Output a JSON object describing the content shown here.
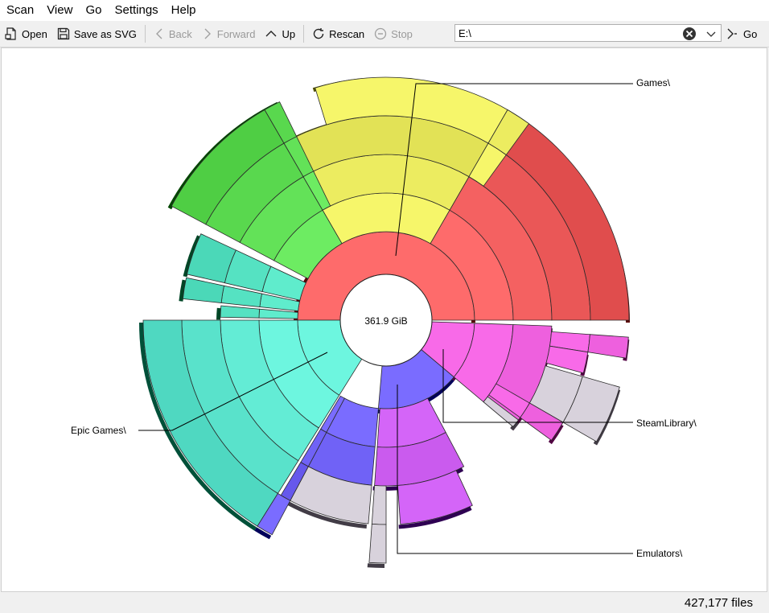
{
  "menu": [
    "Scan",
    "View",
    "Go",
    "Settings",
    "Help"
  ],
  "toolbar": {
    "open": "Open",
    "save_svg": "Save as SVG",
    "back": "Back",
    "forward": "Forward",
    "up": "Up",
    "rescan": "Rescan",
    "stop": "Stop",
    "go": "Go"
  },
  "address": {
    "value": "E:\\"
  },
  "chart": {
    "center_label": "361.9 GiB",
    "labels": {
      "games": "Games\\",
      "steam": "SteamLibrary\\",
      "emulators": "Emulators\\",
      "epic": "Epic Games\\"
    }
  },
  "status": {
    "files": "427,177 files"
  },
  "colors": {
    "games": "#ee5b5b",
    "yellow": "#e6e65a",
    "green": "#5ddc52",
    "teal": "#4fdcbc",
    "epic": "#5de6cf",
    "blue": "#6a5cf0",
    "purple": "#c455e8",
    "steam": "#e85ad8",
    "grey": "#d8d2dc"
  }
}
